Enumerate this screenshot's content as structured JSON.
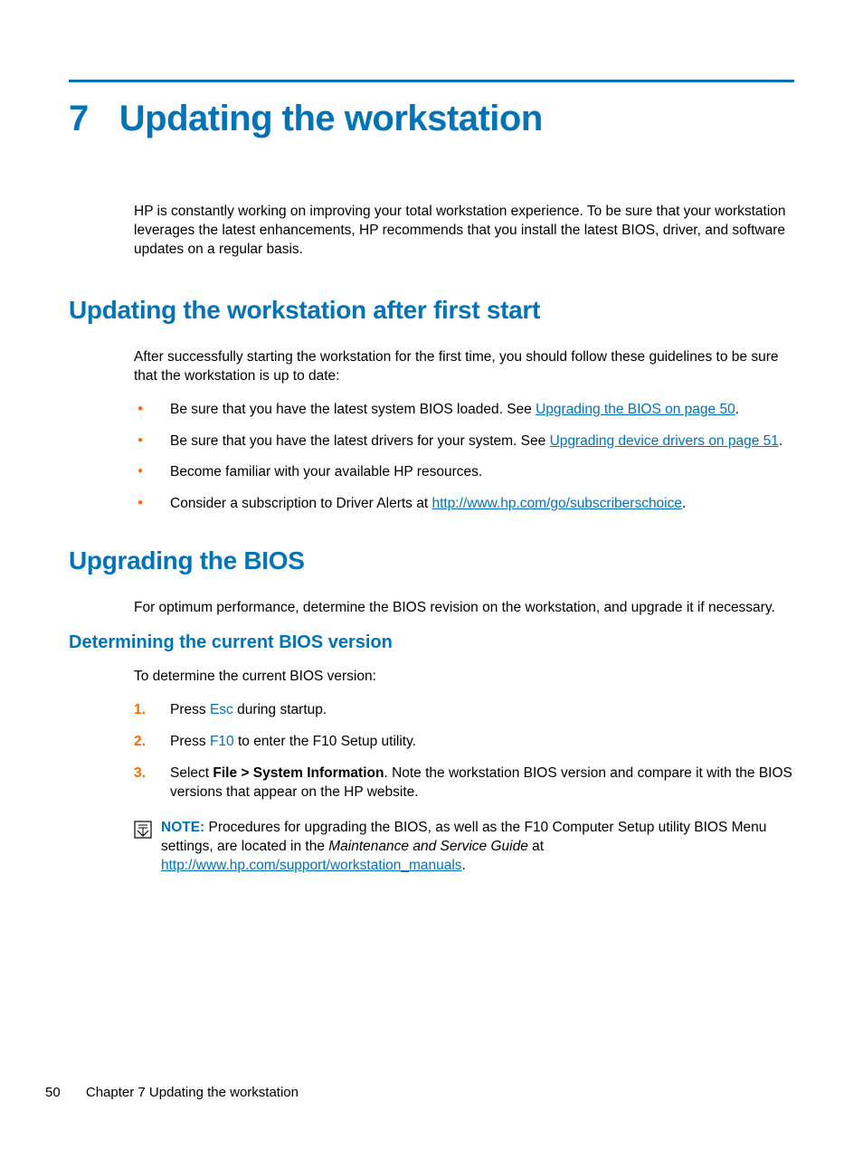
{
  "chapter": {
    "number": "7",
    "title": "Updating the workstation"
  },
  "intro": "HP is constantly working on improving your total workstation experience. To be sure that your workstation leverages the latest enhancements, HP recommends that you install the latest BIOS, driver, and software updates on a regular basis.",
  "section1": {
    "heading": "Updating the workstation after first start",
    "para": "After successfully starting the workstation for the first time, you should follow these guidelines to be sure that the workstation is up to date:",
    "b1a": "Be sure that you have the latest system BIOS loaded. See ",
    "b1link": "Upgrading the BIOS on page 50",
    "b1b": ".",
    "b2a": "Be sure that you have the latest drivers for your system. See ",
    "b2link": "Upgrading device drivers on page 51",
    "b2b": ".",
    "b3": "Become familiar with your available HP resources.",
    "b4a": "Consider a subscription to Driver Alerts at ",
    "b4link": "http://www.hp.com/go/subscriberschoice",
    "b4b": "."
  },
  "section2": {
    "heading": "Upgrading the BIOS",
    "para": "For optimum performance, determine the BIOS revision on the workstation, and upgrade it if necessary.",
    "sub": {
      "heading": "Determining the current BIOS version",
      "para": "To determine the current BIOS version:",
      "s1a": "Press ",
      "s1key": "Esc",
      "s1b": " during startup.",
      "s2a": "Press ",
      "s2key": "F10",
      "s2b": " to enter the F10 Setup utility.",
      "s3a": "Select ",
      "s3bold": "File > System Information",
      "s3b": ". Note the workstation BIOS version and compare it with the BIOS versions that appear on the HP website.",
      "note_label": "NOTE:",
      "note_a": "Procedures for upgrading the BIOS, as well as the F10 Computer Setup utility BIOS Menu settings, are located in the ",
      "note_italic": "Maintenance and Service Guide",
      "note_b": " at ",
      "note_link": "http://www.hp.com/support/workstation_manuals",
      "note_c": "."
    }
  },
  "footer": {
    "page": "50",
    "chapter_label": "Chapter 7   Updating the workstation"
  }
}
